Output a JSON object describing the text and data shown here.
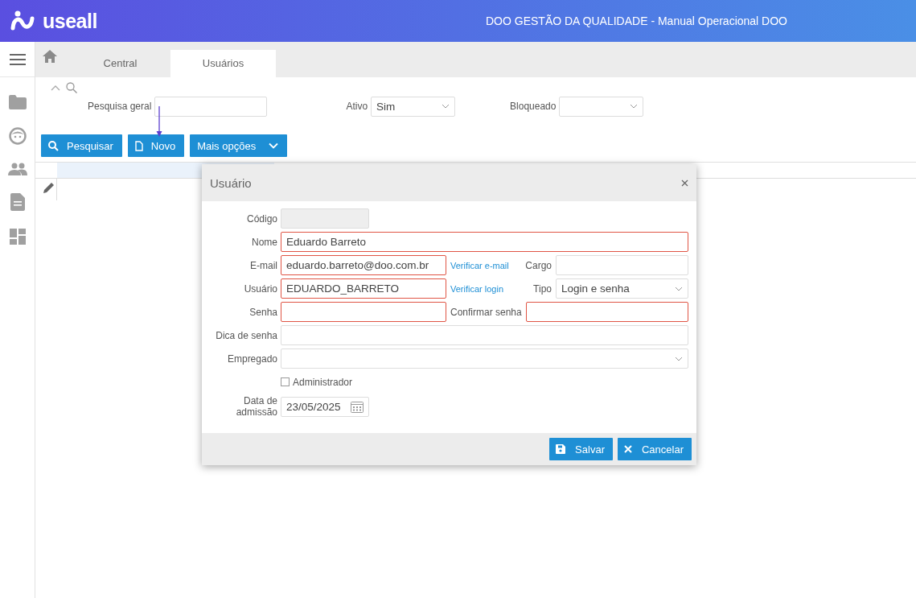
{
  "header": {
    "logo_text": "useall",
    "title": "DOO GESTÃO DA QUALIDADE - Manual Operacional DOO"
  },
  "tabs": [
    {
      "label": "Central",
      "selected": false
    },
    {
      "label": "Usuários",
      "selected": true
    }
  ],
  "filters": [
    {
      "label": "Pesquisa geral",
      "kind": "text"
    },
    {
      "label": "Ativo",
      "kind": "select",
      "value": "Sim"
    },
    {
      "label": "Bloqueado",
      "kind": "select"
    }
  ],
  "buttons": [
    {
      "label": "Pesquisar",
      "kind": "search"
    },
    {
      "label": "Novo",
      "kind": "new"
    },
    {
      "label": "Mais opções",
      "kind": "menu"
    }
  ],
  "dialog": {
    "title": "Usuário",
    "rows": [
      [
        {
          "label": "Código",
          "kind": "text",
          "disabled": true
        }
      ],
      [
        {
          "label": "Nome",
          "kind": "text",
          "value": "Eduardo Barreto",
          "invalid": true
        }
      ],
      [
        {
          "label": "E-mail",
          "kind": "text",
          "value": "eduardo.barreto@doo.com.br",
          "invalid": true,
          "link": "Verificar e-mail"
        },
        {
          "label": "Cargo",
          "kind": "text"
        }
      ],
      [
        {
          "label": "Usuário",
          "kind": "text",
          "value": "EDUARDO_BARRETO",
          "invalid": true,
          "link": "Verificar login"
        },
        {
          "label": "Tipo",
          "kind": "select",
          "value": "Login e senha"
        }
      ],
      [
        {
          "label": "Senha",
          "kind": "text",
          "invalid": true
        },
        {
          "label": "Confirmar senha",
          "kind": "text",
          "invalid": true
        }
      ],
      [
        {
          "label": "Dica de senha",
          "kind": "text"
        }
      ],
      [
        {
          "label": "Empregado",
          "kind": "select"
        }
      ],
      [
        {
          "label": "Administrador",
          "kind": "checkbox",
          "checked": false
        }
      ],
      [
        {
          "label": "Data de admissão",
          "kind": "date",
          "value": "23/05/2025"
        }
      ]
    ],
    "buttons": [
      {
        "label": "Salvar",
        "kind": "save"
      },
      {
        "label": "Cancelar",
        "kind": "cancel"
      }
    ]
  }
}
